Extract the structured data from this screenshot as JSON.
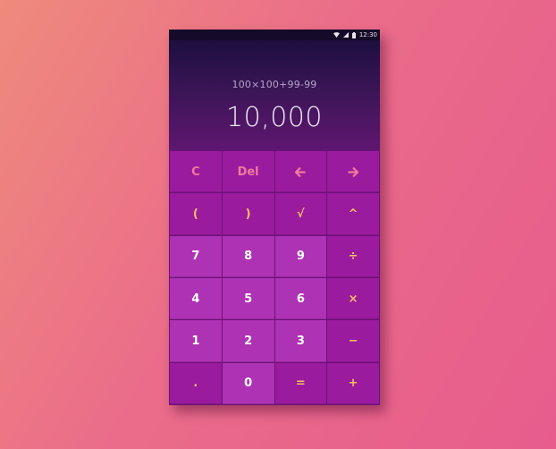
{
  "status_bar": {
    "time": "12:30",
    "icons": [
      "wifi-icon",
      "signal-icon",
      "battery-icon"
    ]
  },
  "display": {
    "expression": "100×100+99-99",
    "result": "10,000"
  },
  "keys": {
    "clear": "C",
    "delete": "Del",
    "left_arrow_icon": "arrow-left-icon",
    "right_arrow_icon": "arrow-right-icon",
    "open_paren": "(",
    "close_paren": ")",
    "sqrt": "√",
    "power": "^",
    "seven": "7",
    "eight": "8",
    "nine": "9",
    "divide": "÷",
    "four": "4",
    "five": "5",
    "six": "6",
    "multiply": "×",
    "one": "1",
    "two": "2",
    "three": "3",
    "minus": "−",
    "dot": ".",
    "zero": "0",
    "equals": "=",
    "plus": "+"
  },
  "colors": {
    "accent_top_row": "#f07a9a",
    "accent_operators": "#f7c15e",
    "digit_key_bg": "#ae32b4",
    "function_key_bg": "#9a1b9e"
  }
}
